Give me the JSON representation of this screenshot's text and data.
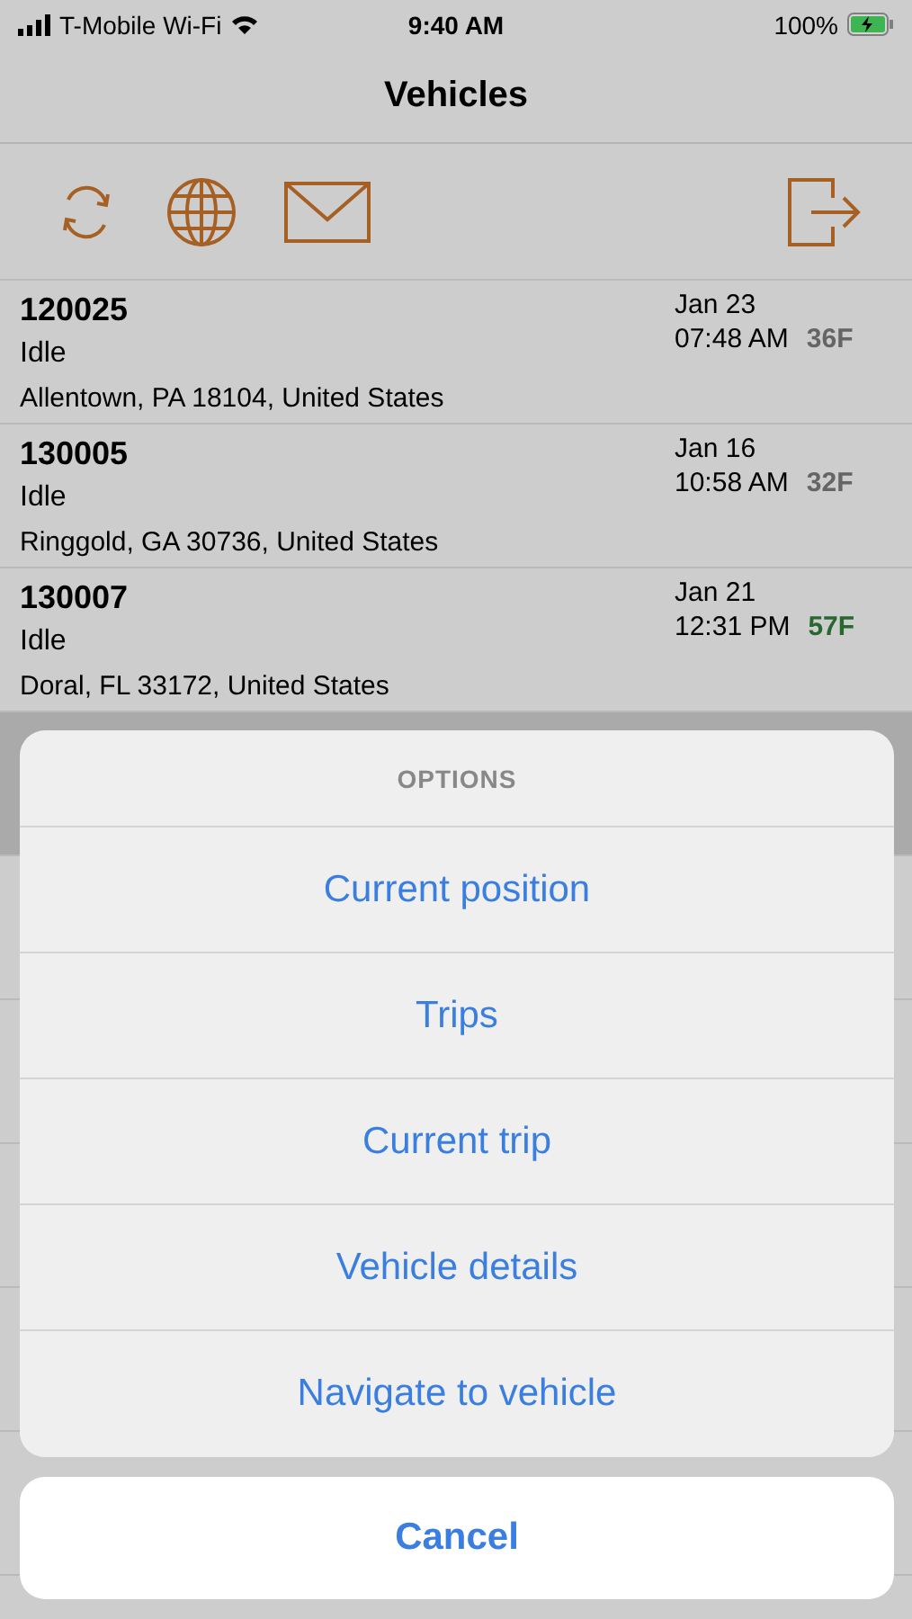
{
  "status_bar": {
    "carrier": "T-Mobile Wi-Fi",
    "time": "9:40 AM",
    "battery": "100%"
  },
  "nav_bar": {
    "title": "Vehicles"
  },
  "vehicles": [
    {
      "id": "120025",
      "status": "Idle",
      "address": "Allentown, PA 18104, United States",
      "date": "Jan 23",
      "time": "07:48 AM",
      "temp": "36F",
      "color": "#7a7a7a",
      "selected": false
    },
    {
      "id": "130005",
      "status": "Idle",
      "address": "Ringgold, GA 30736, United States",
      "date": "Jan 16",
      "time": "10:58 AM",
      "temp": "32F",
      "color": "#7a7a7a",
      "selected": false
    },
    {
      "id": "130007",
      "status": "Idle",
      "address": "Doral, FL 33172, United States",
      "date": "Jan 21",
      "time": "12:31 PM",
      "temp": "57F",
      "color": "#2e7d3a",
      "selected": false
    },
    {
      "selected": true
    },
    {
      "selected": false
    },
    {
      "selected": false
    },
    {
      "selected": false
    },
    {
      "selected": false
    },
    {
      "selected": false
    }
  ],
  "action_sheet": {
    "title": "OPTIONS",
    "options": [
      "Current position",
      "Trips",
      "Current trip",
      "Vehicle details",
      "Navigate to vehicle"
    ],
    "cancel": "Cancel"
  }
}
